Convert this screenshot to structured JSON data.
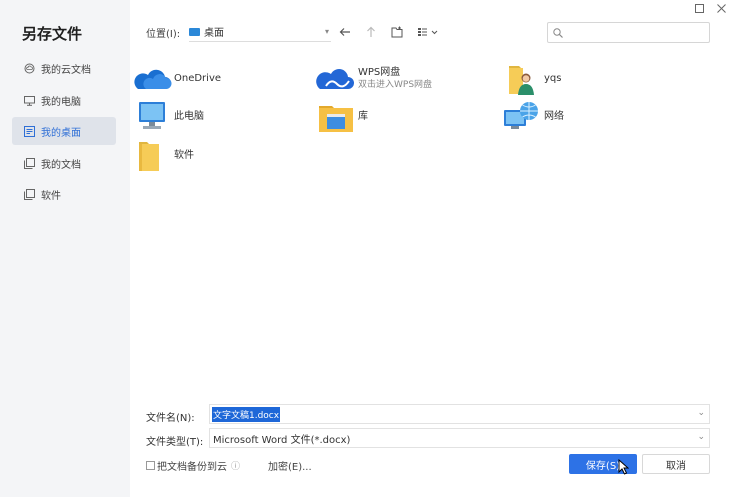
{
  "dialog": {
    "title": "另存文件"
  },
  "sidebar": {
    "items": [
      {
        "label": "我的云文档",
        "icon": "cloud-icon"
      },
      {
        "label": "我的电脑",
        "icon": "monitor-icon"
      },
      {
        "label": "我的桌面",
        "icon": "desktop-icon",
        "active": true
      },
      {
        "label": "我的文档",
        "icon": "document-icon"
      },
      {
        "label": "软件",
        "icon": "folder-icon"
      }
    ]
  },
  "toolbar": {
    "location_label": "位置(I):",
    "location_value": "桌面",
    "search_placeholder": ""
  },
  "files": [
    {
      "name": "OneDrive",
      "sub": "",
      "icon": "onedrive-icon"
    },
    {
      "name": "WPS网盘",
      "sub": "双击进入WPS网盘",
      "icon": "wps-cloud-icon"
    },
    {
      "name": "yqs",
      "sub": "",
      "icon": "user-folder-icon"
    },
    {
      "name": "此电脑",
      "sub": "",
      "icon": "computer-icon"
    },
    {
      "name": "库",
      "sub": "",
      "icon": "library-icon"
    },
    {
      "name": "网络",
      "sub": "",
      "icon": "network-icon"
    },
    {
      "name": "软件",
      "sub": "",
      "icon": "folder-icon"
    }
  ],
  "form": {
    "filename_label": "文件名(N):",
    "filename_value": "文字文稿1.docx",
    "filetype_label": "文件类型(T):",
    "filetype_value": "Microsoft Word 文件(*.docx)",
    "backup_label": "把文档备份到云",
    "encrypt_label": "加密(E)...",
    "save_label": "保存(S)",
    "cancel_label": "取消"
  },
  "colors": {
    "accent": "#2d72e6",
    "selection": "#1e67d8",
    "sidebar_bg": "#f4f5f7",
    "active_item_bg": "#dfe3ea"
  }
}
